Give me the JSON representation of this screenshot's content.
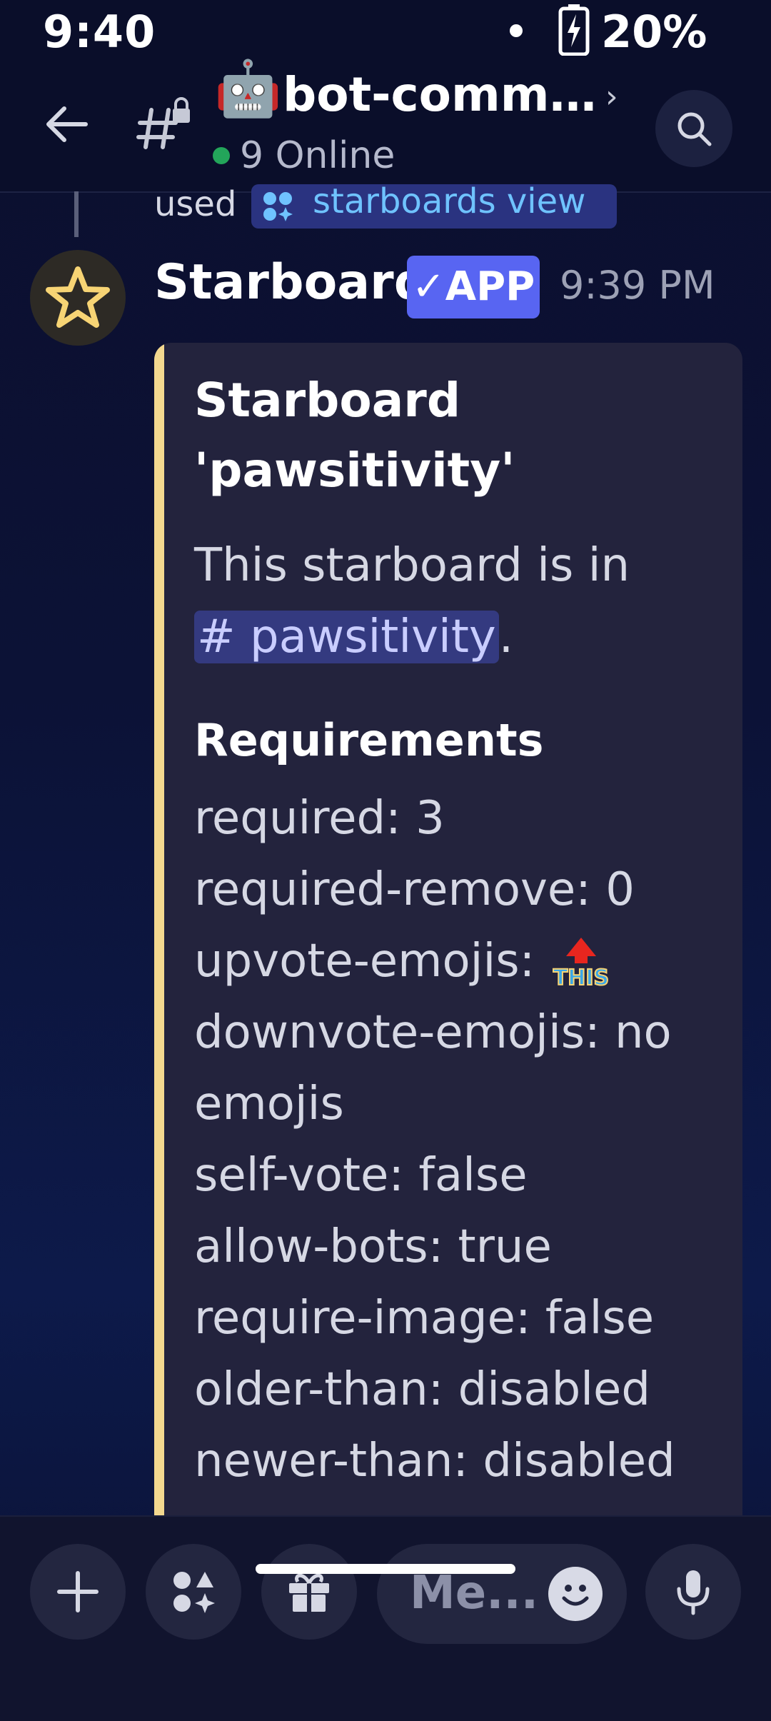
{
  "status_bar": {
    "time": "9:40",
    "battery": "20%"
  },
  "header": {
    "channel_emoji": "🤖",
    "channel_name": "bot-comm...",
    "online": "9 Online"
  },
  "reply": {
    "used": "used",
    "command": "starboards view"
  },
  "message": {
    "author": "Starboard",
    "badge": "✓APP",
    "time": "9:39 PM"
  },
  "embed": {
    "title_line1": "Starboard",
    "title_line2": "'pawsitivity'",
    "desc_prefix": "This starboard is in ",
    "mention": "# pawsitivity",
    "desc_suffix": ".",
    "subtitle": "Requirements",
    "requirements": {
      "required": "required: 3",
      "required_remove": "required-remove: 0",
      "upvote": "upvote-emojis: ",
      "upvote_emoji_text": "THIS",
      "downvote_1": "downvote-emojis: no",
      "downvote_2": "emojis",
      "self_vote": "self-vote: false",
      "allow_bots": "allow-bots: true",
      "require_image": "require-image: false",
      "older_than": "older-than: disabled",
      "newer_than": "newer-than: disabled"
    }
  },
  "composer": {
    "placeholder": "Me..."
  },
  "colors": {
    "accent": "#5865f2",
    "embed_bar": "#f3d88f",
    "online": "#23a55a",
    "command_text": "#6fc3ff"
  }
}
